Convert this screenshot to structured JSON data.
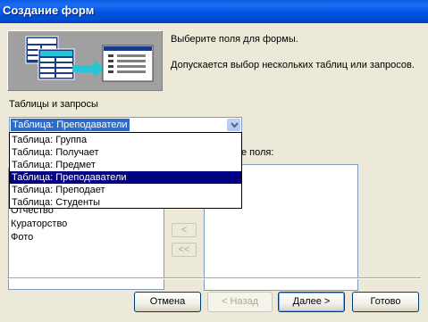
{
  "window": {
    "title": "Создание форм"
  },
  "description": {
    "line1": "Выберите поля для формы.",
    "line2": "Допускается выбор нескольких таблиц или запросов."
  },
  "tables": {
    "label": "Таблицы и запросы",
    "selected_value": "Таблица: Преподаватели",
    "options": [
      "Таблица: Группа",
      "Таблица: Получает",
      "Таблица: Предмет",
      "Таблица: Преподаватели",
      "Таблица: Преподает",
      "Таблица: Студенты"
    ],
    "highlighted_index": 3
  },
  "available_fields": {
    "visible_items": [
      "Отчество",
      "Кураторство",
      "Фото"
    ]
  },
  "selected_fields": {
    "label_visible": "ные поля:"
  },
  "move_buttons": {
    "remove_one": "<",
    "remove_all": "<<"
  },
  "buttons": {
    "cancel": "Отмена",
    "back": "< Назад",
    "next": "Далее >",
    "finish": "Готово"
  }
}
